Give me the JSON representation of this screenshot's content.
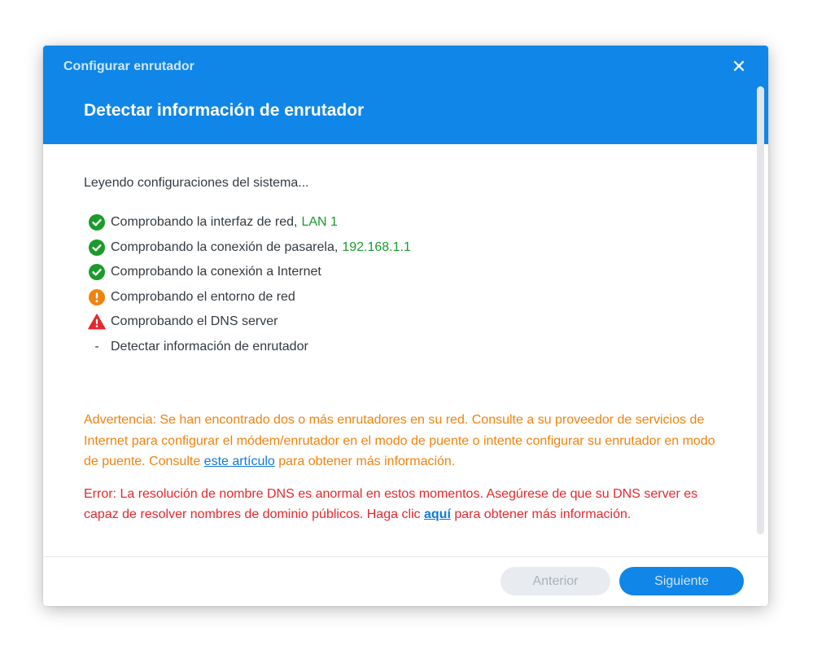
{
  "dialog": {
    "window_title": "Configurar enrutador",
    "step_title": "Detectar información de enrutador",
    "close_glyph": "✕"
  },
  "content": {
    "intro": "Leyendo configuraciones del sistema...",
    "checks": [
      {
        "status": "success",
        "icon": "check-circle-icon",
        "label": "Comprobando la interfaz de red",
        "separator": ",",
        "value": "LAN 1"
      },
      {
        "status": "success",
        "icon": "check-circle-icon",
        "label": "Comprobando la conexión de pasarela",
        "separator": ",",
        "value": "192.168.1.1"
      },
      {
        "status": "success",
        "icon": "check-circle-icon",
        "label": "Comprobando la conexión a Internet"
      },
      {
        "status": "warning",
        "icon": "exclamation-circle-icon",
        "label": "Comprobando el entorno de red"
      },
      {
        "status": "error",
        "icon": "warning-triangle-icon",
        "label": "Comprobando el DNS server"
      },
      {
        "status": "pending",
        "icon": "dash",
        "dash": "-",
        "label": "Detectar información de enrutador"
      }
    ],
    "warning": {
      "before_link": "Advertencia: Se han encontrado dos o más enrutadores en su red. Consulte a su proveedor de servicios de Internet para configurar el módem/enrutador en el modo de puente o intente configurar su enrutador en modo de puente. Consulte ",
      "link": "este artículo",
      "after_link": " para obtener más información."
    },
    "error": {
      "before_link": "Error: La resolución de nombre DNS es anormal en estos momentos. Asegúrese de que su DNS server es capaz de resolver nombres de dominio públicos. Haga clic ",
      "link": "aquí",
      "after_link": " para obtener más información."
    }
  },
  "footer": {
    "prev_label": "Anterior",
    "next_label": "Siguiente"
  },
  "colors": {
    "header": "#0f86e8",
    "success": "#1b9b2b",
    "warning": "#f0820f",
    "error": "#e5282e",
    "link": "#0f78d8"
  }
}
